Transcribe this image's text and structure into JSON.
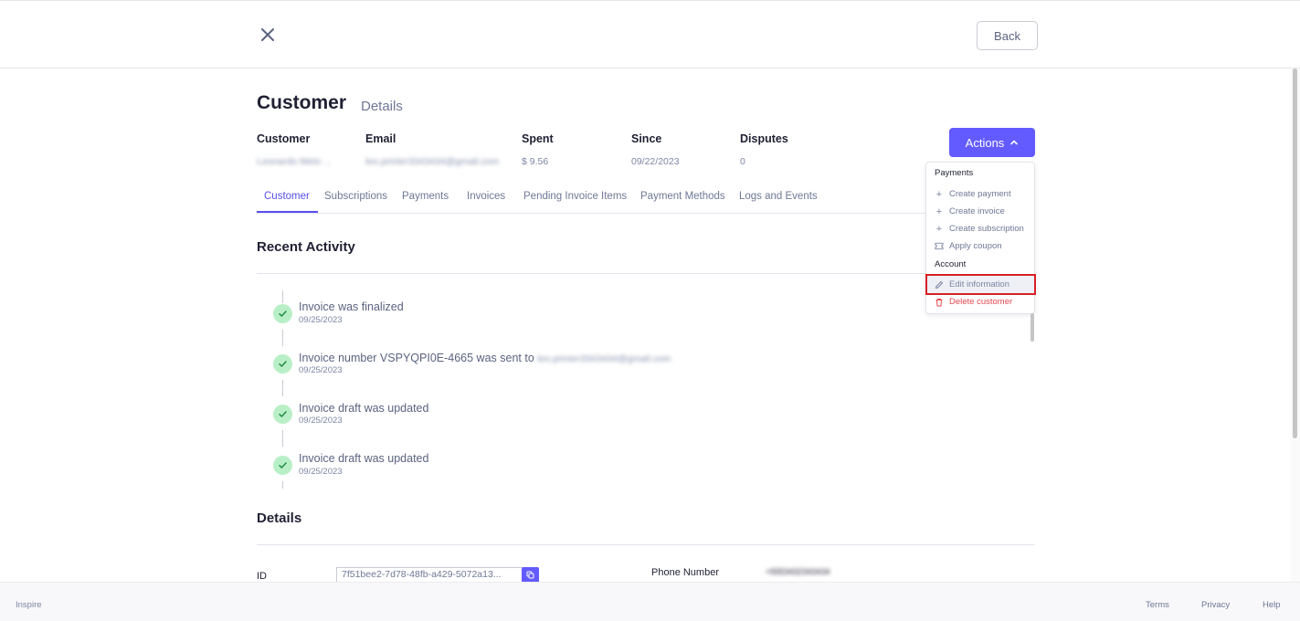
{
  "header": {
    "back_label": "Back",
    "title": "Customer",
    "subtitle": "Details",
    "actions_label": "Actions"
  },
  "summary": {
    "customer_label": "Customer",
    "customer_value": "Leonardo Melo ...",
    "email_label": "Email",
    "email_value": "leo.printer3343434@gmail.com",
    "spent_label": "Spent",
    "spent_value": "$ 9.56",
    "since_label": "Since",
    "since_value": "09/22/2023",
    "disputes_label": "Disputes",
    "disputes_value": "0"
  },
  "tabs": [
    {
      "label": "Customer",
      "active": true
    },
    {
      "label": "Subscriptions"
    },
    {
      "label": "Payments"
    },
    {
      "label": "Invoices"
    },
    {
      "label": "Pending Invoice Items"
    },
    {
      "label": "Payment Methods"
    },
    {
      "label": "Logs and Events"
    }
  ],
  "recent_activity": {
    "title": "Recent Activity",
    "items": [
      {
        "text": "Invoice was finalized",
        "date": "09/25/2023"
      },
      {
        "text": "Invoice number VSPYQPI0E-4665 was sent to",
        "email": "leo.printer3343434@gmail.com",
        "date": "09/25/2023"
      },
      {
        "text": "Invoice draft was updated",
        "date": "09/25/2023"
      },
      {
        "text": "Invoice draft was updated",
        "date": "09/25/2023"
      }
    ]
  },
  "details": {
    "title": "Details",
    "id_label": "ID",
    "id_value": "7f51bee2-7d78-48fb-a429-5072a13...",
    "phone_label": "Phone Number",
    "phone_value": "+5553432343434"
  },
  "dropdown": {
    "payments_heading": "Payments",
    "create_payment": "Create payment",
    "create_invoice": "Create invoice",
    "create_subscription": "Create subscription",
    "apply_coupon": "Apply coupon",
    "account_heading": "Account",
    "edit_information": "Edit information",
    "delete_customer": "Delete customer"
  },
  "footer": {
    "brand": "Inspire",
    "terms": "Terms",
    "privacy": "Privacy",
    "help": "Help"
  },
  "colors": {
    "accent": "#635bff",
    "success_bg": "#b9efc7",
    "danger": "#e5484d",
    "highlight_border": "#d61f26"
  },
  "icons": {
    "close": "close-icon",
    "chevron": "chevron-up-icon",
    "check": "check-icon",
    "plus": "plus-icon",
    "coupon": "ticket-icon",
    "edit": "pencil-icon",
    "delete": "trash-icon",
    "copy": "copy-icon"
  }
}
